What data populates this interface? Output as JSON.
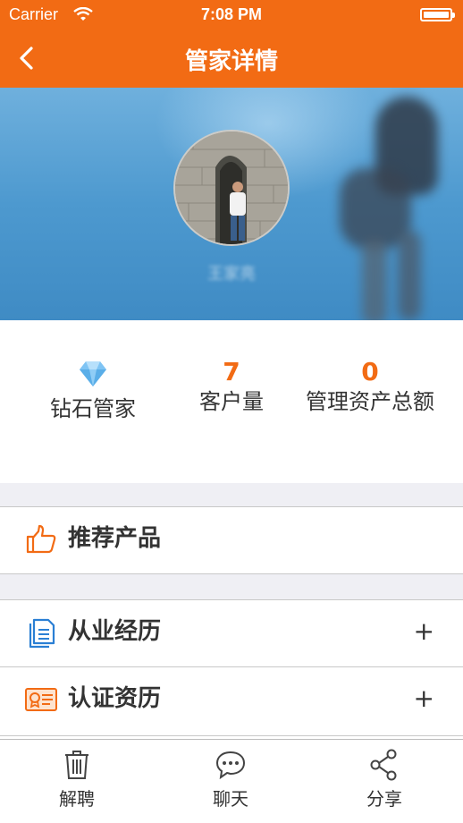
{
  "status_bar": {
    "carrier": "Carrier",
    "time": "7:08 PM"
  },
  "nav": {
    "title": "管家详情",
    "back_icon": "chevron-left-icon"
  },
  "profile": {
    "name": "王家亮"
  },
  "stats": [
    {
      "icon": "diamond-icon",
      "value": "",
      "label": "钻石管家"
    },
    {
      "value": "7",
      "label": "客户量"
    },
    {
      "value": "0",
      "label": "管理资产总额"
    }
  ],
  "sections": {
    "recommend": {
      "label": "推荐产品",
      "icon": "thumbs-up-icon"
    },
    "experience": {
      "label": "从业经历",
      "icon": "document-icon",
      "action": "+"
    },
    "certification": {
      "label": "认证资历",
      "icon": "certificate-icon",
      "action": "+"
    }
  },
  "tabbar": [
    {
      "label": "解聘",
      "icon": "trash-icon"
    },
    {
      "label": "聊天",
      "icon": "chat-icon"
    },
    {
      "label": "分享",
      "icon": "share-icon"
    }
  ],
  "colors": {
    "accent": "#f26b14",
    "separator": "#efeff4",
    "icon_blue": "#2a7fd4"
  }
}
